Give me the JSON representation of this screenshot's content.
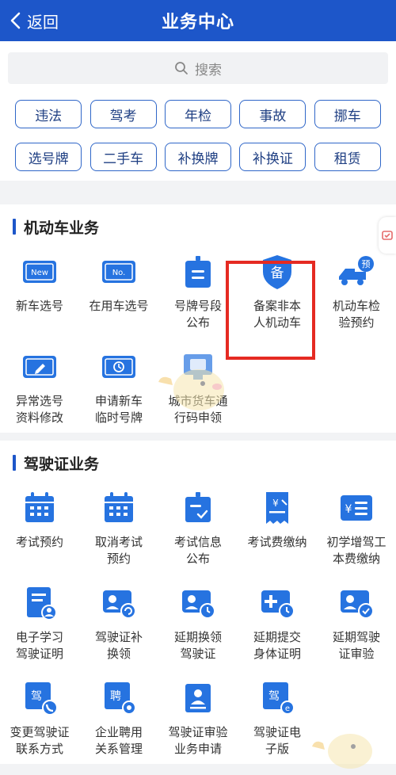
{
  "header": {
    "back_label": "返回",
    "title": "业务中心"
  },
  "search": {
    "placeholder": "搜索"
  },
  "quick_tags": [
    "违法",
    "驾考",
    "年检",
    "事故",
    "挪车",
    "选号牌",
    "二手车",
    "补换牌",
    "补换证",
    "租赁"
  ],
  "vehicle_section": {
    "title": "机动车业务",
    "items": [
      {
        "label": "新车选号",
        "icon": "new-plate-icon"
      },
      {
        "label": "在用车选号",
        "icon": "no-plate-icon"
      },
      {
        "label": "号牌号段\n公布",
        "icon": "sign-board-icon"
      },
      {
        "label": "备案非本\n人机动车",
        "icon": "shield-bei-icon"
      },
      {
        "label": "机动车检\n验预约",
        "icon": "truck-yu-icon"
      },
      {
        "label": "异常选号\n资料修改",
        "icon": "plate-edit-icon"
      },
      {
        "label": "申请新车\n临时号牌",
        "icon": "plate-clock-icon"
      },
      {
        "label": "城市货车通\n行码申领",
        "icon": "freight-pass-icon"
      }
    ]
  },
  "license_section": {
    "title": "驾驶证业务",
    "items": [
      {
        "label": "考试预约",
        "icon": "calendar-icon"
      },
      {
        "label": "取消考试\n预约",
        "icon": "calendar-cancel-icon"
      },
      {
        "label": "考试信息\n公布",
        "icon": "board-check-icon"
      },
      {
        "label": "考试费缴纳",
        "icon": "receipt-pay-icon"
      },
      {
        "label": "初学增驾工\n本费缴纳",
        "icon": "yen-list-icon"
      },
      {
        "label": "电子学习\n驾驶证明",
        "icon": "doc-user-icon"
      },
      {
        "label": "驾驶证补\n换领",
        "icon": "card-refresh-icon"
      },
      {
        "label": "延期换领\n驾驶证",
        "icon": "card-clock-icon"
      },
      {
        "label": "延期提交\n身体证明",
        "icon": "plus-clock-icon"
      },
      {
        "label": "延期驾驶\n证审验",
        "icon": "card-check-icon"
      },
      {
        "label": "变更驾驶证\n联系方式",
        "icon": "jia-phone-icon"
      },
      {
        "label": "企业聘用\n关系管理",
        "icon": "pin-gear-icon"
      },
      {
        "label": "驾驶证审验\n业务申请",
        "icon": "person-badge-icon"
      },
      {
        "label": "驾驶证电\n子版",
        "icon": "jia-e-icon"
      }
    ]
  },
  "colors": {
    "primary": "#1d56c9",
    "icon_blue": "#2673e0",
    "highlight": "#e52a22"
  }
}
